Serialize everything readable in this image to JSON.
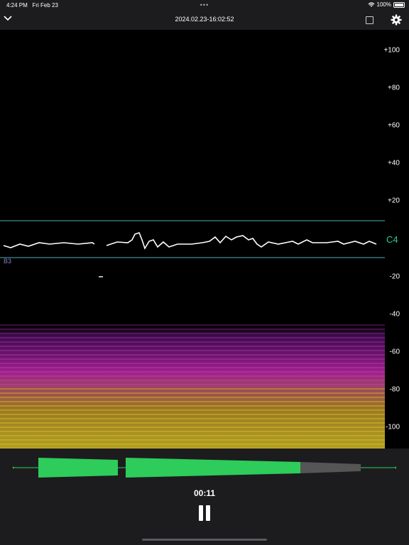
{
  "status": {
    "time": "4:24 PM",
    "date": "Fri Feb 23",
    "battery": "100%"
  },
  "nav": {
    "title": "2024.02.23-16:02:52",
    "more": "•••"
  },
  "scale": {
    "ticks": [
      "+100",
      "+80",
      "+60",
      "+40",
      "+20",
      "-20",
      "-40",
      "-60",
      "-80",
      "-100"
    ]
  },
  "pitch": {
    "current_note": "C4",
    "lower_note": "B3"
  },
  "playback": {
    "time": "00:11",
    "progress": 0.75
  },
  "colors": {
    "note_accent": "#2fc7a0",
    "lower_note": "#8a7fd8",
    "waveform_played": "#2ecc5a",
    "waveform_unplayed": "#555555",
    "guide_line": "#4ab0b8"
  },
  "icons": {
    "collapse": "chevron-down-icon",
    "export": "export-icon",
    "settings": "gear-icon",
    "wifi": "wifi-icon",
    "battery": "battery-icon",
    "pause": "pause-icon"
  }
}
